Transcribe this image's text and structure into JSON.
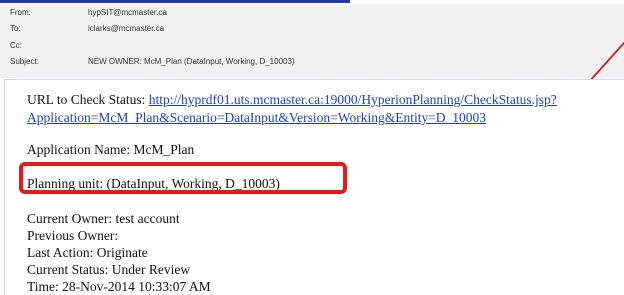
{
  "header": {
    "from_label": "From:",
    "from_value": "hypSIT@mcmaster.ca",
    "to_label": "To:",
    "to_value": "iclarks@mcmaster.ca",
    "cc_label": "Cc:",
    "cc_value": "",
    "subject_label": "Subject:",
    "subject_value": "NEW OWNER: McM_Plan (DataInput, Working, D_10003)"
  },
  "body": {
    "url_label": "URL to Check Status:",
    "url_line1": "http://hyprdf01.uts.mcmaster.ca:19000/HyperionPlanning/CheckStatus.jsp?",
    "url_line2": "Application=McM_Plan&Scenario=DataInput&Version=Working&Entity=D_10003",
    "application_name": "Application Name: McM_Plan",
    "planning_unit": "Planning unit: (DataInput, Working, D_10003)",
    "current_owner": "Current Owner: test account",
    "previous_owner": "Previous Owner:",
    "last_action": "Last Action: Originate",
    "current_status": "Current Status: Under Review",
    "time": "Time: 28-Nov-2014 10:33:07 AM"
  },
  "colors": {
    "highlight": "#e11b1b",
    "link": "#1f3fbf",
    "header_bg": "#f2f2f2"
  }
}
